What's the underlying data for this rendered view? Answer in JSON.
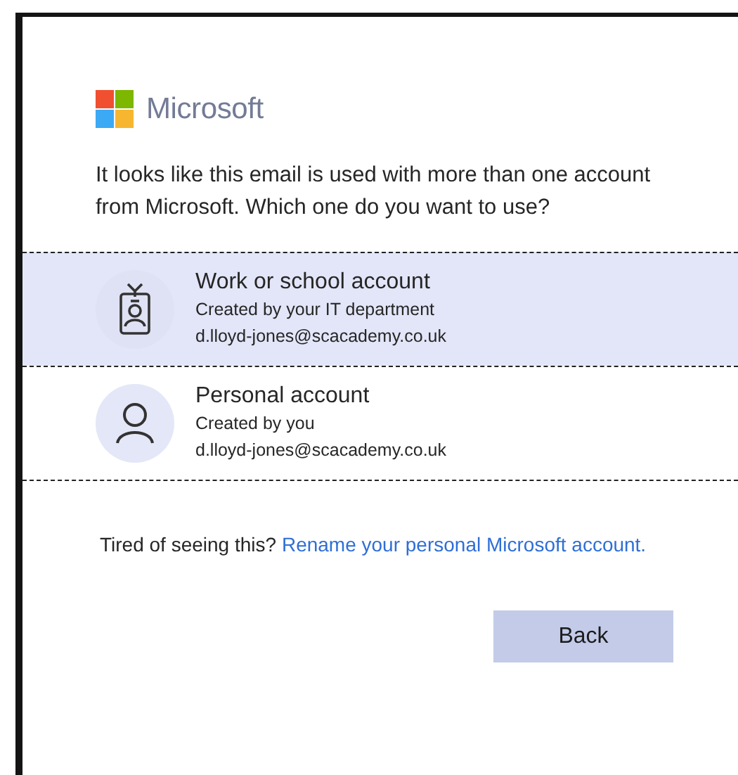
{
  "brand": {
    "name": "Microsoft"
  },
  "message": "It looks like this email is used with more than one account from Microsoft. Which one do you want to use?",
  "accounts": [
    {
      "kind": "work",
      "title": "Work or school account",
      "subtitle": "Created by your IT department",
      "email": "d.lloyd-jones@scacademy.co.uk",
      "selected": true
    },
    {
      "kind": "personal",
      "title": "Personal account",
      "subtitle": "Created by you",
      "email": "d.lloyd-jones@scacademy.co.uk",
      "selected": false
    }
  ],
  "footer": {
    "text": "Tired of seeing this?",
    "link": "Rename your personal Microsoft account."
  },
  "buttons": [
    {
      "label": "Back"
    }
  ]
}
